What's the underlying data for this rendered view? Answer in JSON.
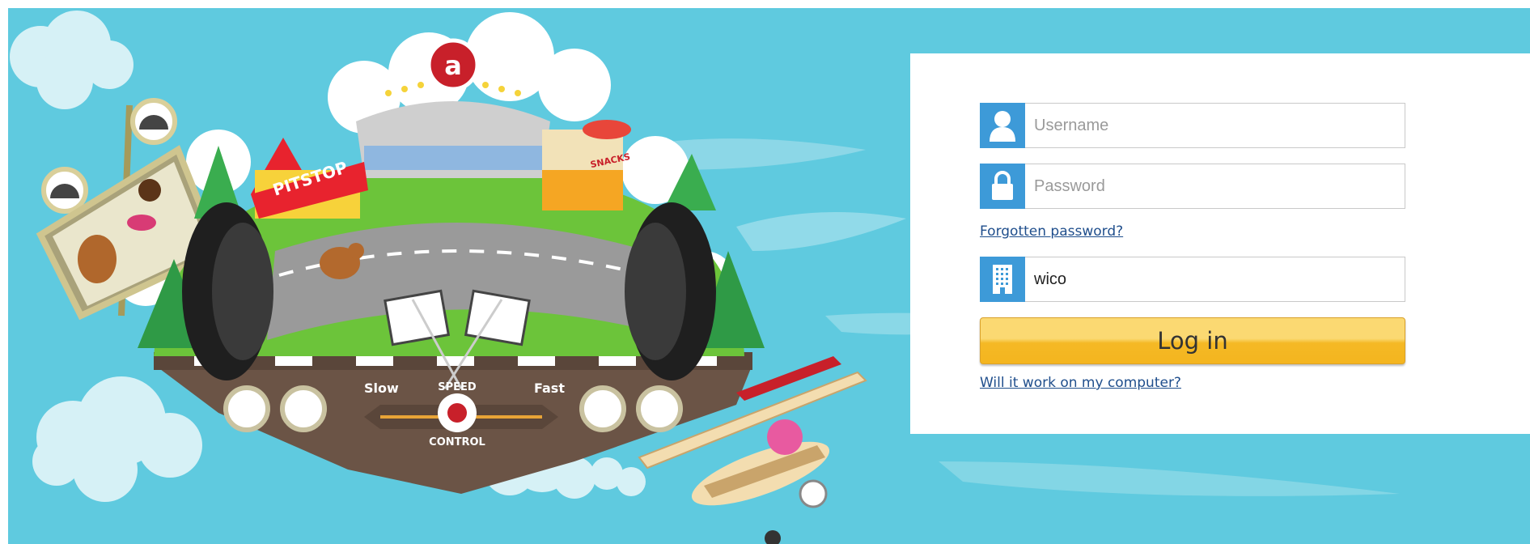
{
  "login": {
    "username_placeholder": "Username",
    "password_placeholder": "Password",
    "forgotten_password": "Forgotten password?",
    "school_value": "wico",
    "login_button": "Log in",
    "compat_link": "Will it work on my computer?"
  },
  "illustration": {
    "pitstop_label": "PITSTOP",
    "snacks_label": "SNACKS",
    "slow_label": "Slow",
    "fast_label": "Fast",
    "speed_label": "SPEED",
    "control_label": "CONTROL",
    "logo_letter": "a"
  },
  "colors": {
    "sky": "#5fcadf",
    "icon_blue": "#3d9ad8",
    "button_yellow": "#f5b925",
    "link_blue": "#1f4e8c"
  },
  "icons": {
    "username": "user-icon",
    "password": "lock-icon",
    "school": "building-icon"
  }
}
